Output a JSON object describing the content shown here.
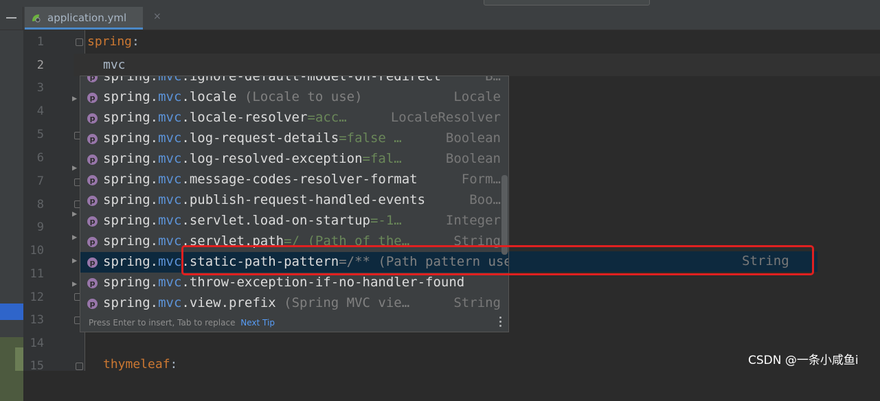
{
  "tab": {
    "file_name": "application.yml",
    "close_glyph": "×",
    "icon": "spring-leaf-icon"
  },
  "editor": {
    "line_numbers": [
      "1",
      "2",
      "3",
      "4",
      "5",
      "6",
      "7",
      "8",
      "9",
      "10",
      "11",
      "12",
      "13",
      "14",
      "15"
    ],
    "current_line": "2",
    "line1_key": "spring",
    "line1_colon": ":",
    "line2_text": "mvc",
    "line15_key": "thymeleaf",
    "line15_colon": ":"
  },
  "completion": {
    "items": [
      {
        "prefix": "spring.",
        "mvc": "mvc",
        "rest": ".ignore-default-model-on-redirect",
        "hint": "",
        "type": "B…"
      },
      {
        "prefix": "spring.",
        "mvc": "mvc",
        "rest": ".locale",
        "hint": " (Locale to use)",
        "type": "Locale"
      },
      {
        "prefix": "spring.",
        "mvc": "mvc",
        "rest": ".locale-resolver",
        "hint": "=acc…",
        "type": "LocaleResolver"
      },
      {
        "prefix": "spring.",
        "mvc": "mvc",
        "rest": ".log-request-details",
        "hint": "=false …",
        "type": "Boolean"
      },
      {
        "prefix": "spring.",
        "mvc": "mvc",
        "rest": ".log-resolved-exception",
        "hint": "=fal…",
        "type": "Boolean"
      },
      {
        "prefix": "spring.",
        "mvc": "mvc",
        "rest": ".message-codes-resolver-format",
        "hint": "",
        "type": "Form…"
      },
      {
        "prefix": "spring.",
        "mvc": "mvc",
        "rest": ".publish-request-handled-events",
        "hint": "",
        "type": "Boo…"
      },
      {
        "prefix": "spring.",
        "mvc": "mvc",
        "rest": ".servlet.load-on-startup",
        "hint": "=-1…",
        "type": "Integer"
      },
      {
        "prefix": "spring.",
        "mvc": "mvc",
        "rest": ".servlet.path",
        "hint": "=/ (Path of the…",
        "type": "String"
      },
      {
        "prefix": "spring.",
        "mvc": "mvc",
        "rest": ".static-path-pattern",
        "hint": "=/** (Path pattern used for static resources)",
        "type": "String"
      },
      {
        "prefix": "spring.",
        "mvc": "mvc",
        "rest": ".throw-exception-if-no-handler-found",
        "hint": "",
        "type": ""
      },
      {
        "prefix": "spring.",
        "mvc": "mvc",
        "rest": ".view.prefix",
        "hint": " (Spring MVC vie…",
        "type": "String"
      }
    ],
    "property_badge": "p",
    "selected_index": 9,
    "footer_text": "Press Enter to insert, Tab to replace",
    "footer_link": "Next Tip"
  },
  "watermark": "CSDN @一条小咸鱼i",
  "colors": {
    "keyword": "#cc7832",
    "mvc": "#5c93d8",
    "default": "#6a8759",
    "selection": "#0d293e",
    "highlight_box": "#e02020"
  }
}
